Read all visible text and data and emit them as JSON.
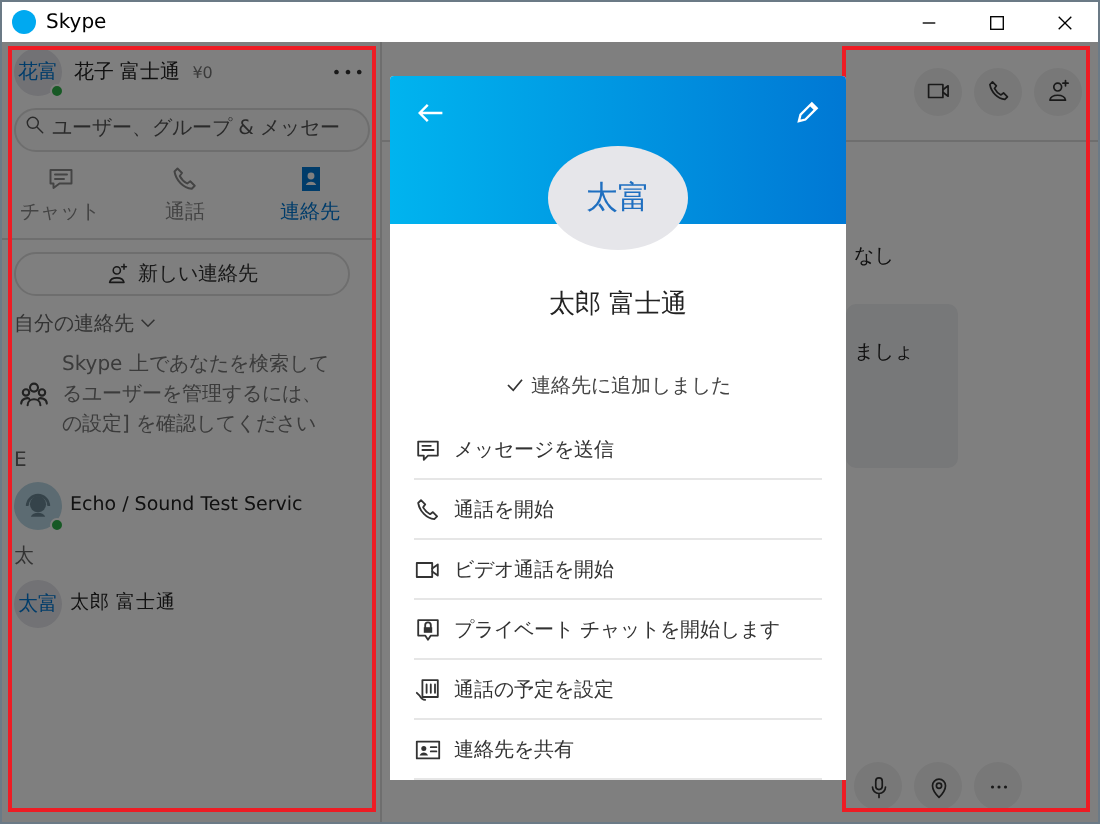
{
  "window": {
    "title": "Skype"
  },
  "sidebar": {
    "highlighted": true,
    "profile": {
      "initials": "花富",
      "name": "花子 富士通",
      "credit": "¥0",
      "online": true,
      "more": "•••"
    },
    "search": {
      "placeholder": "ユーザー、グループ & メッセー"
    },
    "tabs": [
      {
        "label": "チャット",
        "kind": "chat",
        "selected": false
      },
      {
        "label": "通話",
        "kind": "call",
        "selected": false
      },
      {
        "label": "連絡先",
        "kind": "contacts",
        "selected": true
      }
    ],
    "new_contact": "新しい連絡先",
    "contacts_header": "自分の連絡先",
    "info_lines": [
      "Skype 上であなたを検索して",
      "るユーザーを管理するには、",
      "の設定] を確認してください"
    ],
    "groups": [
      {
        "letter": "E",
        "contacts": [
          {
            "kind": "bot",
            "name": "Echo / Sound Test Servic",
            "online": true
          }
        ]
      },
      {
        "letter": "太",
        "contacts": [
          {
            "kind": "initials",
            "initials": "太富",
            "name": "太郎 富士通",
            "online": false
          }
        ]
      }
    ]
  },
  "chat": {
    "highlighted": true,
    "header_buttons": [
      {
        "kind": "video"
      },
      {
        "kind": "call"
      },
      {
        "kind": "add-person"
      }
    ],
    "fragments": [
      {
        "kind": "plain",
        "text": "なし"
      },
      {
        "kind": "bubble",
        "text": "ましょ"
      }
    ],
    "bottom_buttons": [
      {
        "kind": "mic"
      },
      {
        "kind": "location"
      },
      {
        "kind": "more"
      }
    ]
  },
  "profile_card": {
    "initials": "太富",
    "name": "太郎 富士通",
    "status": "連絡先に追加しました",
    "actions": [
      {
        "kind": "message",
        "label": "メッセージを送信"
      },
      {
        "kind": "call",
        "label": "通話を開始"
      },
      {
        "kind": "video",
        "label": "ビデオ通話を開始"
      },
      {
        "kind": "lock",
        "label": "プライベート チャットを開始します"
      },
      {
        "kind": "schedule",
        "label": "通話の予定を設定"
      },
      {
        "kind": "card",
        "label": "連絡先を共有"
      }
    ]
  }
}
